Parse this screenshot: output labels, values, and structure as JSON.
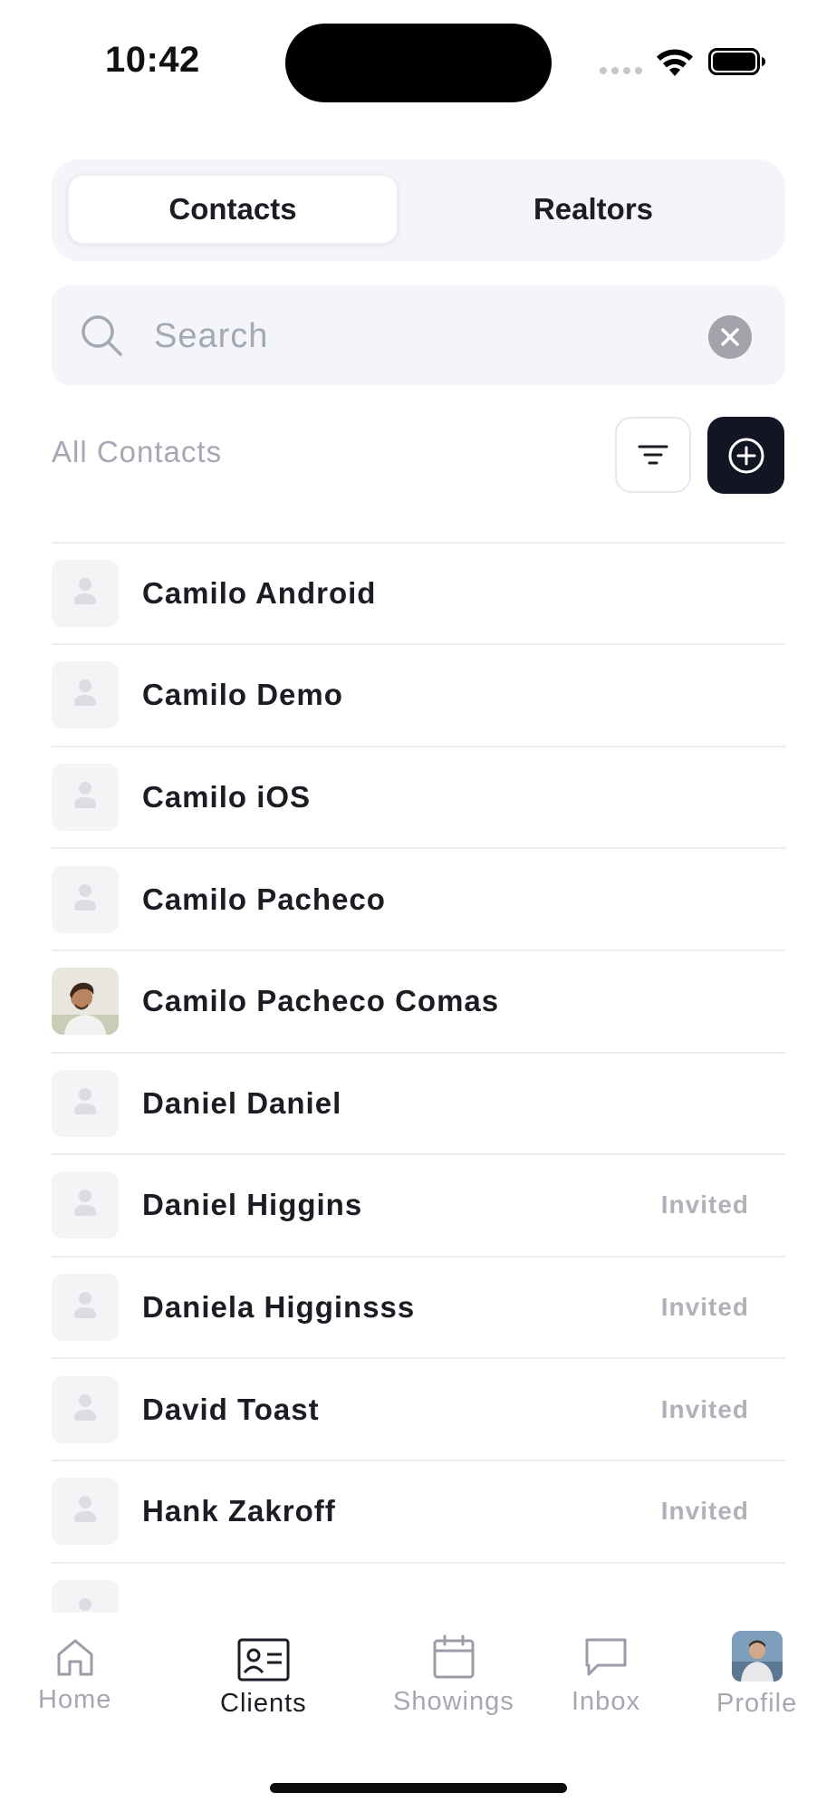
{
  "status_bar": {
    "time": "10:42"
  },
  "segmented": {
    "tabs": [
      {
        "label": "Contacts",
        "active": true
      },
      {
        "label": "Realtors",
        "active": false
      }
    ]
  },
  "search": {
    "placeholder": "Search",
    "value": ""
  },
  "section": {
    "title": "All Contacts"
  },
  "contacts": [
    {
      "name": "",
      "status": "",
      "photo": false
    },
    {
      "name": "Camilo Android",
      "status": "",
      "photo": false
    },
    {
      "name": "Camilo Demo",
      "status": "",
      "photo": false
    },
    {
      "name": "Camilo iOS",
      "status": "",
      "photo": false
    },
    {
      "name": "Camilo Pacheco",
      "status": "",
      "photo": false
    },
    {
      "name": "Camilo Pacheco Comas",
      "status": "",
      "photo": true
    },
    {
      "name": "Daniel Daniel",
      "status": "",
      "photo": false
    },
    {
      "name": "Daniel Higgins",
      "status": "Invited",
      "photo": false
    },
    {
      "name": "Daniela Higginsss",
      "status": "Invited",
      "photo": false
    },
    {
      "name": "David Toast",
      "status": "Invited",
      "photo": false
    },
    {
      "name": "Hank Zakroff",
      "status": "Invited",
      "photo": false
    },
    {
      "name": "",
      "status": "",
      "photo": false
    }
  ],
  "tabbar": {
    "items": [
      {
        "label": "Home",
        "icon": "home-icon",
        "active": false
      },
      {
        "label": "Clients",
        "icon": "contact-card-icon",
        "active": true
      },
      {
        "label": "Showings",
        "icon": "calendar-icon",
        "active": false
      },
      {
        "label": "Inbox",
        "icon": "chat-bubble-icon",
        "active": false
      },
      {
        "label": "Profile",
        "icon": "profile-avatar",
        "active": false
      }
    ]
  },
  "colors": {
    "primary_dark": "#131524",
    "muted_text": "#a5a8b3",
    "surface": "#f3f5fa",
    "divider": "#ececf0"
  }
}
